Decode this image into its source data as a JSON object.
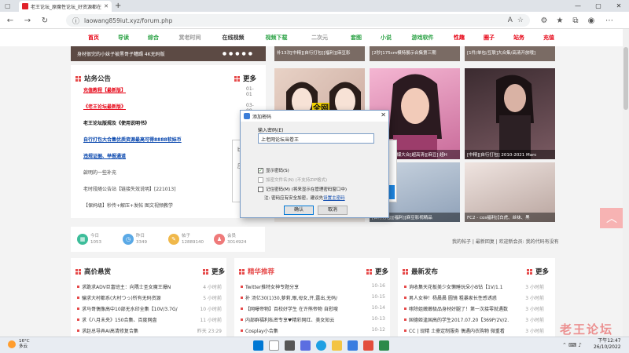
{
  "browser": {
    "tab_title": "老王论坛_原魔性论坛_好资源都在",
    "url": "laowang859iut.xyz/forum.php"
  },
  "nav": {
    "items": [
      {
        "label": "首页",
        "color": "#e60012"
      },
      {
        "label": "导读",
        "color": "#2ba245"
      },
      {
        "label": "综合",
        "color": "#2ba245"
      },
      {
        "label": "赏老时间",
        "color": "#999999"
      },
      {
        "label": "在线视频",
        "color": "#333333"
      },
      {
        "label": "视频下载",
        "color": "#2ba245"
      },
      {
        "label": "二次元",
        "color": "#999999"
      },
      {
        "label": "套图",
        "color": "#2ba245"
      },
      {
        "label": "小说",
        "color": "#2ba245"
      },
      {
        "label": "游戏软件",
        "color": "#2ba245"
      },
      {
        "label": "性趣",
        "color": "#e60012"
      },
      {
        "label": "圈子",
        "color": "#e60012"
      },
      {
        "label": "站务",
        "color": "#e60012"
      },
      {
        "label": "充值",
        "color": "#e60012"
      }
    ]
  },
  "banner": {
    "text": "身材很完的小妹子被黑哥子糟蹋 4K无码版",
    "thumbs": [
      "补13次[中精][自行打包][福利][麻豆影",
      "[2秒]175cm模特展示合集第三期",
      "[1件/单包/互联]大合集/高清开放哦]"
    ]
  },
  "notice": {
    "title": "站务公告",
    "more": "更多",
    "rows": [
      {
        "text": "充值教程【最新版】",
        "style": "red"
      },
      {
        "text": "《老王论坛最新版》",
        "style": "red"
      },
      {
        "text": "老王论坛版规及《使用说明书》",
        "style": "black"
      },
      {
        "text": "自行打包大合集优质资源最高可得8888软妹币",
        "style": "blue"
      },
      {
        "text": "违规证据、举报通道",
        "style": "blue"
      },
      {
        "text": "啟明的一些补充",
        "style": "plain"
      },
      {
        "text": "老时段随公告站【链接失效说明】[221013]",
        "style": "plain"
      },
      {
        "text": "【保妈级】秒传+解压+发帖 图文视频教学",
        "style": "plain"
      }
    ],
    "dates": [
      "01-01",
      "03-08",
      "08-",
      "",
      "",
      "",
      "",
      ""
    ]
  },
  "photos": [
    {
      "caption": "",
      "badge": "全网最"
    },
    {
      "caption": "[自行打包]大爆大合[超高清][麻豆] 超H",
      "badge": ""
    },
    {
      "caption": "[中精][自行打包] 2010-2021 Marc",
      "badge": ""
    },
    {
      "caption": "[自行打包][福利][麻豆影视精品",
      "badge": ""
    },
    {
      "caption": "FC2 - cos福利[【白虎、丝袜、黑",
      "badge": ""
    }
  ],
  "stats": [
    {
      "label": "今日",
      "value": "1053",
      "icon": "calendar-icon",
      "color": "#3dbd9a",
      "glyph": "▦"
    },
    {
      "label": "昨日",
      "value": "3349",
      "icon": "clock-icon",
      "color": "#5aa9e6",
      "glyph": "◷"
    },
    {
      "label": "帖子",
      "value": "12889140",
      "icon": "post-icon",
      "color": "#f0b84a",
      "glyph": "✎"
    },
    {
      "label": "会员",
      "value": "3014924",
      "icon": "user-icon",
      "color": "#ef7a7a",
      "glyph": "♟"
    }
  ],
  "user_line": "我的帖子 | 最新回复 | 欢迎新会员: 我的代码有没有",
  "lists": [
    {
      "title": "高价悬赏",
      "more": "更多",
      "rows": [
        {
          "text": "求跪求ADV巨富班主：向隅士圣女魔王爆N",
          "time": "4 小时前"
        },
        {
          "text": "骗求大村都系(大村つっ)所有无码资源",
          "time": "5 小时前"
        },
        {
          "text": "求马哥偶像高中10部无水印全集【10V/3.7G/",
          "time": "10 小时前"
        },
        {
          "text": "求《八月未央》150合集、百度网盘",
          "time": "11 小时前"
        },
        {
          "text": "求赵总导弄AI高清修复合集",
          "time": "昨天 23:29"
        },
        {
          "text": "求 普贤哥 写真合集【90.5GB】【哀盘】",
          "time": "昨天 23:15"
        }
      ]
    },
    {
      "title": "精华推荐",
      "more": "更多",
      "rows": [
        {
          "text": "Twitter推特女神专题分享",
          "time": "10-16"
        },
        {
          "text": "补 汤亿30(1)30,萝莉,眼,母女,开,露出,无码/",
          "time": "10-15"
        },
        {
          "text": "【网曝帝物】百校好学生 在许熊帝物 自慰嗖",
          "time": "10-14"
        },
        {
          "text": "内部群福利私密专享♥精彩网红、美女知云",
          "time": "10-13"
        },
        {
          "text": "Cosplay小合集",
          "time": "10-12"
        },
        {
          "text": "仙路尽头疲力峰！3D极品/全动态玩爆][大坐",
          "time": "10-12"
        }
      ]
    },
    {
      "title": "最新发布",
      "more": "更多",
      "rows": [
        {
          "text": "询收集天花板美少女懒睡玩朵小B钻【1V/1.1",
          "time": "3 小时前"
        },
        {
          "text": "男人女神！杨晨晨 圆镜 粗暴家长性感诱惑",
          "time": "3 小时前"
        },
        {
          "text": "嗦除姐嫩嫩极品身材好腿了！第一次接零就遇数",
          "time": "3 小时前"
        },
        {
          "text": "国德姬逢国高的学生2017.07.20【369P/2V/2.",
          "time": "3 小时前"
        },
        {
          "text": "CC | 现精 土豪定制服务 偶遇内衣购物 微重看",
          "time": "3 小时前"
        },
        {
          "text": "小熊妹不小心Addisson合集",
          "time": "3 小时前"
        }
      ]
    }
  ],
  "dialog": {
    "title": "添加密码",
    "label": "输入密码(E)",
    "value": "上老网论坛当卷王",
    "opt1": "显示密码(S)",
    "opt2": "加密文件名(N)  (不支持ZIP格式)",
    "opt3": "记住密码(M)  (将来显示在管理密码窗口中)",
    "note_prefix": "注: 密码应有安全加密，建议先",
    "note_link": "设置主密码",
    "ok": "确认",
    "cancel": "取消"
  },
  "taskbar": {
    "temp": "16°C",
    "weather": "多云",
    "time": "下午12:47",
    "date": "26/10/2022"
  },
  "watermark": "老王论坛"
}
